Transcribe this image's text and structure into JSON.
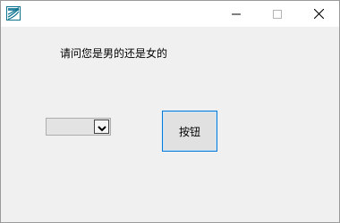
{
  "window": {
    "title": "",
    "icon": "app-icon",
    "controls": {
      "minimize_icon": "minimize-icon",
      "maximize_icon": "maximize-icon",
      "close_icon": "close-icon"
    }
  },
  "form": {
    "question_label": "请问您是男的还是女的",
    "combo": {
      "selected_value": "",
      "arrow_icon": "chevron-down-icon"
    },
    "button_label": "按钮"
  },
  "colors": {
    "window_bg": "#f0f0f0",
    "titlebar_bg": "#ffffff",
    "button_border": "#0078d7",
    "app_icon_color": "#0e7490"
  }
}
